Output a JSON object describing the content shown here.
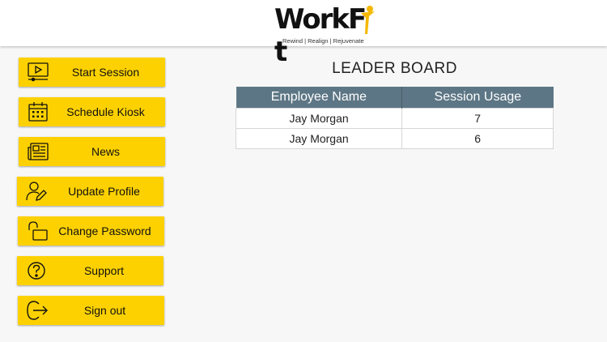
{
  "app": {
    "logo_text": "WorkF t",
    "logo_tagline": "Rewind | Realign | Rejuvenate"
  },
  "colors": {
    "accent_yellow": "#fdd100",
    "table_header": "#5d7685",
    "logo_figure": "#f5b800"
  },
  "sidebar": {
    "items": [
      {
        "label": "Start Session",
        "icon": "play-screen-icon"
      },
      {
        "label": "Schedule Kiosk",
        "icon": "calendar-icon"
      },
      {
        "label": "News",
        "icon": "newspaper-icon"
      },
      {
        "label": "Update Profile",
        "icon": "user-edit-icon"
      },
      {
        "label": "Change Password",
        "icon": "unlock-icon"
      },
      {
        "label": "Support",
        "icon": "help-icon"
      },
      {
        "label": "Sign out",
        "icon": "sign-out-icon"
      }
    ]
  },
  "leaderboard": {
    "title": "LEADER BOARD",
    "columns": [
      "Employee Name",
      "Session Usage"
    ],
    "rows": [
      {
        "name": "Jay Morgan",
        "usage": "7"
      },
      {
        "name": "Jay Morgan",
        "usage": "6"
      }
    ]
  }
}
